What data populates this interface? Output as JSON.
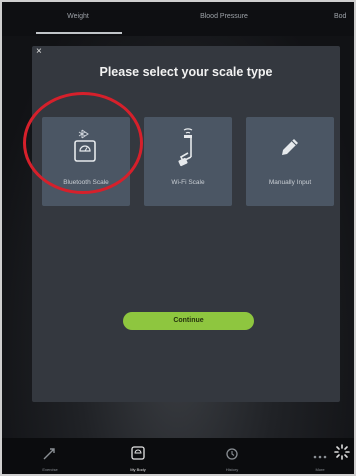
{
  "tabs": [
    {
      "label": "Weight"
    },
    {
      "label": "Blood Pressure"
    },
    {
      "label": "Bod"
    }
  ],
  "modal": {
    "close_label": "×",
    "title": "Please select your scale type",
    "options": [
      {
        "label": "Bluetooth Scale",
        "icon": "bluetooth-scale-icon",
        "highlighted": true
      },
      {
        "label": "Wi-Fi Scale",
        "icon": "wifi-scale-icon",
        "highlighted": false
      },
      {
        "label": "Manually Input",
        "icon": "pencil-icon",
        "highlighted": false
      }
    ],
    "continue_label": "Continue"
  },
  "bottom_nav": [
    {
      "label": "Exercise",
      "icon": "exercise-icon"
    },
    {
      "label": "My Body",
      "icon": "scale-icon",
      "active": true
    },
    {
      "label": "History",
      "icon": "history-icon"
    },
    {
      "label": "More",
      "icon": "more-icon"
    }
  ],
  "colors": {
    "accent_green": "#8ec63f",
    "highlight_red": "#d6202b",
    "card_bg": "#4b5664",
    "modal_bg": "#34383f"
  }
}
